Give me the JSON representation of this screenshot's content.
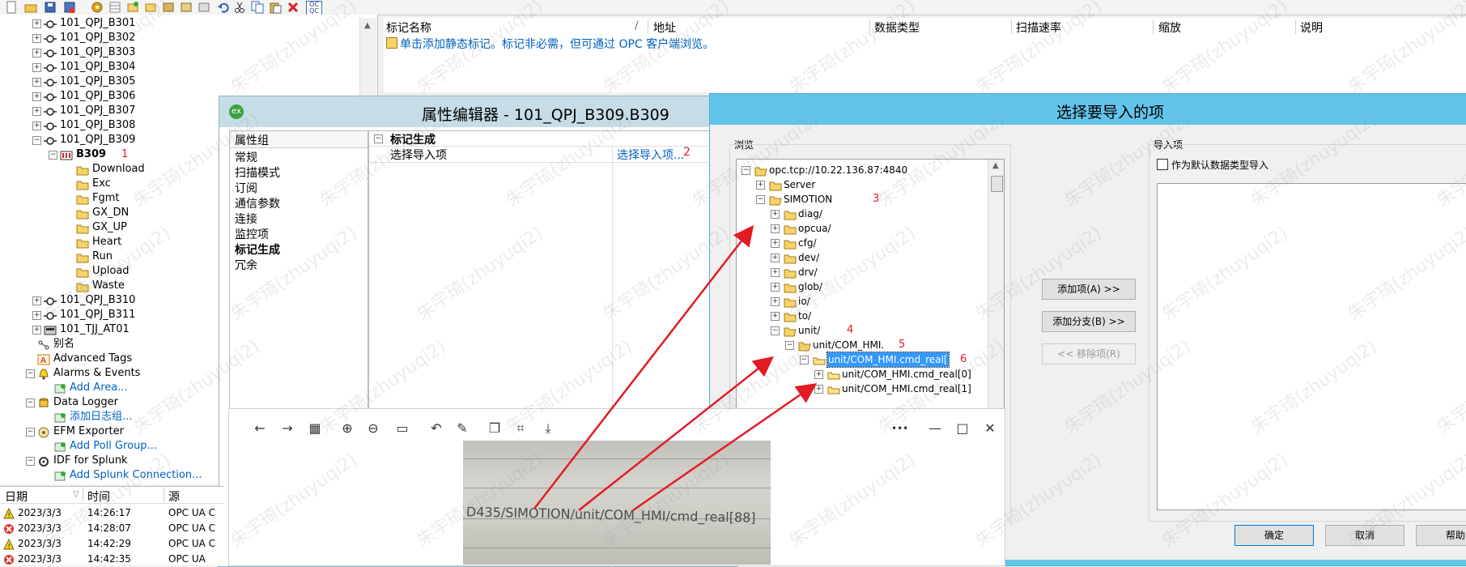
{
  "colors": {
    "accent_link": "#0060c0",
    "annotation_red": "#e31b23",
    "dialog_title_bg": "#63c4ea",
    "pe_title_bg": "#c6dde7",
    "selected_bg": "#3399ff"
  },
  "toolbar": {
    "icons": [
      "new-icon",
      "open-icon",
      "save-icon",
      "save-as-icon",
      "settings-icon",
      "grid-icon",
      "tag-add-icon",
      "group-add-icon",
      "project-icon",
      "properties-icon",
      "undo-icon",
      "cut-icon",
      "copy-icon",
      "paste-icon",
      "delete-icon",
      "opc-qc-icon"
    ],
    "opc_label": "QC"
  },
  "tree": {
    "devices": [
      "101_QPJ_B301",
      "101_QPJ_B302",
      "101_QPJ_B303",
      "101_QPJ_B304",
      "101_QPJ_B305",
      "101_QPJ_B306",
      "101_QPJ_B307",
      "101_QPJ_B308",
      "101_QPJ_B309"
    ],
    "b309": "B309",
    "b309_note": "1",
    "b309_children": [
      "Download",
      "Exc",
      "Fgmt",
      "GX_DN",
      "GX_UP",
      "Heart",
      "Run",
      "Upload",
      "Waste"
    ],
    "devices_after": [
      "101_QPJ_B310",
      "101_QPJ_B311",
      "101_TJJ_AT01"
    ],
    "alias": "别名",
    "advanced_tags": "Advanced Tags",
    "alarms": "Alarms & Events",
    "add_area": "Add Area...",
    "data_logger": "Data Logger",
    "add_log_group": "添加日志组...",
    "efm": "EFM Exporter",
    "add_poll_group": "Add Poll Group...",
    "idf": "IDF for Splunk",
    "add_splunk": "Add Splunk Connection..."
  },
  "list": {
    "columns": [
      "标记名称",
      "地址",
      "数据类型",
      "扫描速率",
      "缩放",
      "说明"
    ],
    "sort_glyph": "/",
    "hint": "单击添加静态标记。标记非必需，但可通过 OPC 客户端浏览。"
  },
  "property_editor": {
    "title": "属性编辑器 - 101_QPJ_B309.B309",
    "group_header": "属性组",
    "groups": [
      "常规",
      "扫描模式",
      "订阅",
      "通信参数",
      "连接",
      "监控项",
      "标记生成",
      "冗余"
    ],
    "active_group": "标记生成",
    "section": "标记生成",
    "prop_name": "选择导入项",
    "prop_value": "选择导入项...",
    "prop_note": "2"
  },
  "import_dialog": {
    "title": "选择要导入的项",
    "browse_label": "浏览",
    "import_label": "导入项",
    "default_type_checkbox": "作为默认数据类型导入",
    "root": "opc.tcp://10.22.136.87:4840",
    "server": "Server",
    "simotion": "SIMOTION",
    "simotion_note": "3",
    "folders": [
      "diag/",
      "opcua/",
      "cfg/",
      "dev/",
      "drv/",
      "glob/",
      "io/",
      "to/"
    ],
    "unit": "unit/",
    "unit_note": "4",
    "com_hmi": "unit/COM_HMI.",
    "com_hmi_note": "5",
    "cmd_real": "unit/COM_HMI.cmd_real[",
    "cmd_real_note": "6",
    "cmd_real_0": "unit/COM_HMI.cmd_real[0]",
    "cmd_real_1": "unit/COM_HMI.cmd_real[1]",
    "btn_add_item": "添加项(A) >>",
    "btn_add_branch": "添加分支(B) >>",
    "btn_remove": "<< 移除项(R)",
    "btn_ok": "确定",
    "btn_cancel": "取消",
    "btn_help": "帮助"
  },
  "log": {
    "columns": [
      "日期",
      "时间",
      "源"
    ],
    "rows": [
      {
        "level": "warning",
        "date": "2023/3/3",
        "time": "14:26:17",
        "source": "OPC UA C"
      },
      {
        "level": "error",
        "date": "2023/3/3",
        "time": "14:28:07",
        "source": "OPC UA C"
      },
      {
        "level": "warning",
        "date": "2023/3/3",
        "time": "14:42:29",
        "source": "OPC UA C"
      },
      {
        "level": "error",
        "date": "2023/3/3",
        "time": "14:42:35",
        "source": "OPC UA Clic"
      }
    ]
  },
  "viewer": {
    "toolbar_icons": [
      "back-icon",
      "forward-icon",
      "thumbnails-icon",
      "zoom-in-icon",
      "zoom-out-icon",
      "actual-size-icon",
      "rotate-icon",
      "edit-icon",
      "copy-icon",
      "crop-icon",
      "save-icon"
    ],
    "more": "•••",
    "minimize": "—",
    "maximize": "□",
    "close": "✕",
    "photo_text": "D435/SIMOTION/unit/COM_HMI/cmd_real[88]"
  },
  "watermark": "朱宇琦(zhuyuqi2)"
}
